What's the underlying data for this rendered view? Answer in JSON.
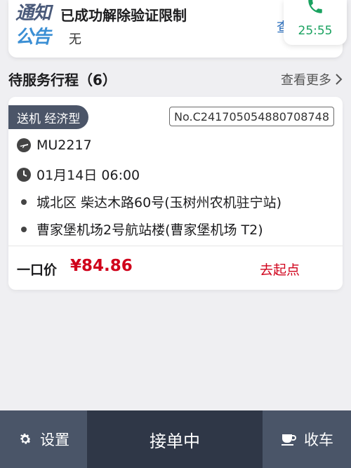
{
  "notice": {
    "logo_line1": "通知",
    "logo_line2": "公告",
    "headline": "已成功解除验证限制",
    "content": "无",
    "view_label": "查"
  },
  "call": {
    "timer": "25:55",
    "icon": "phone-icon",
    "color": "#1aa260"
  },
  "section": {
    "title": "待服务行程（6）",
    "more_label": "查看更多"
  },
  "trip": {
    "tag": "送机 经济型",
    "order_no": "No.C241705054880708748",
    "flight": "MU2217",
    "time": "01月14日 06:00",
    "origin": "城北区 柴达木路60号(玉树州农机驻宁站)",
    "destination": "曹家堡机场2号航站楼(曹家堡机场 T2)",
    "price_label": "一口价",
    "price": "¥84.86",
    "action": "去起点",
    "accent": "#d0021b"
  },
  "bottom_bar": {
    "settings_label": "设置",
    "status_label": "接单中",
    "close_label": "收车"
  }
}
